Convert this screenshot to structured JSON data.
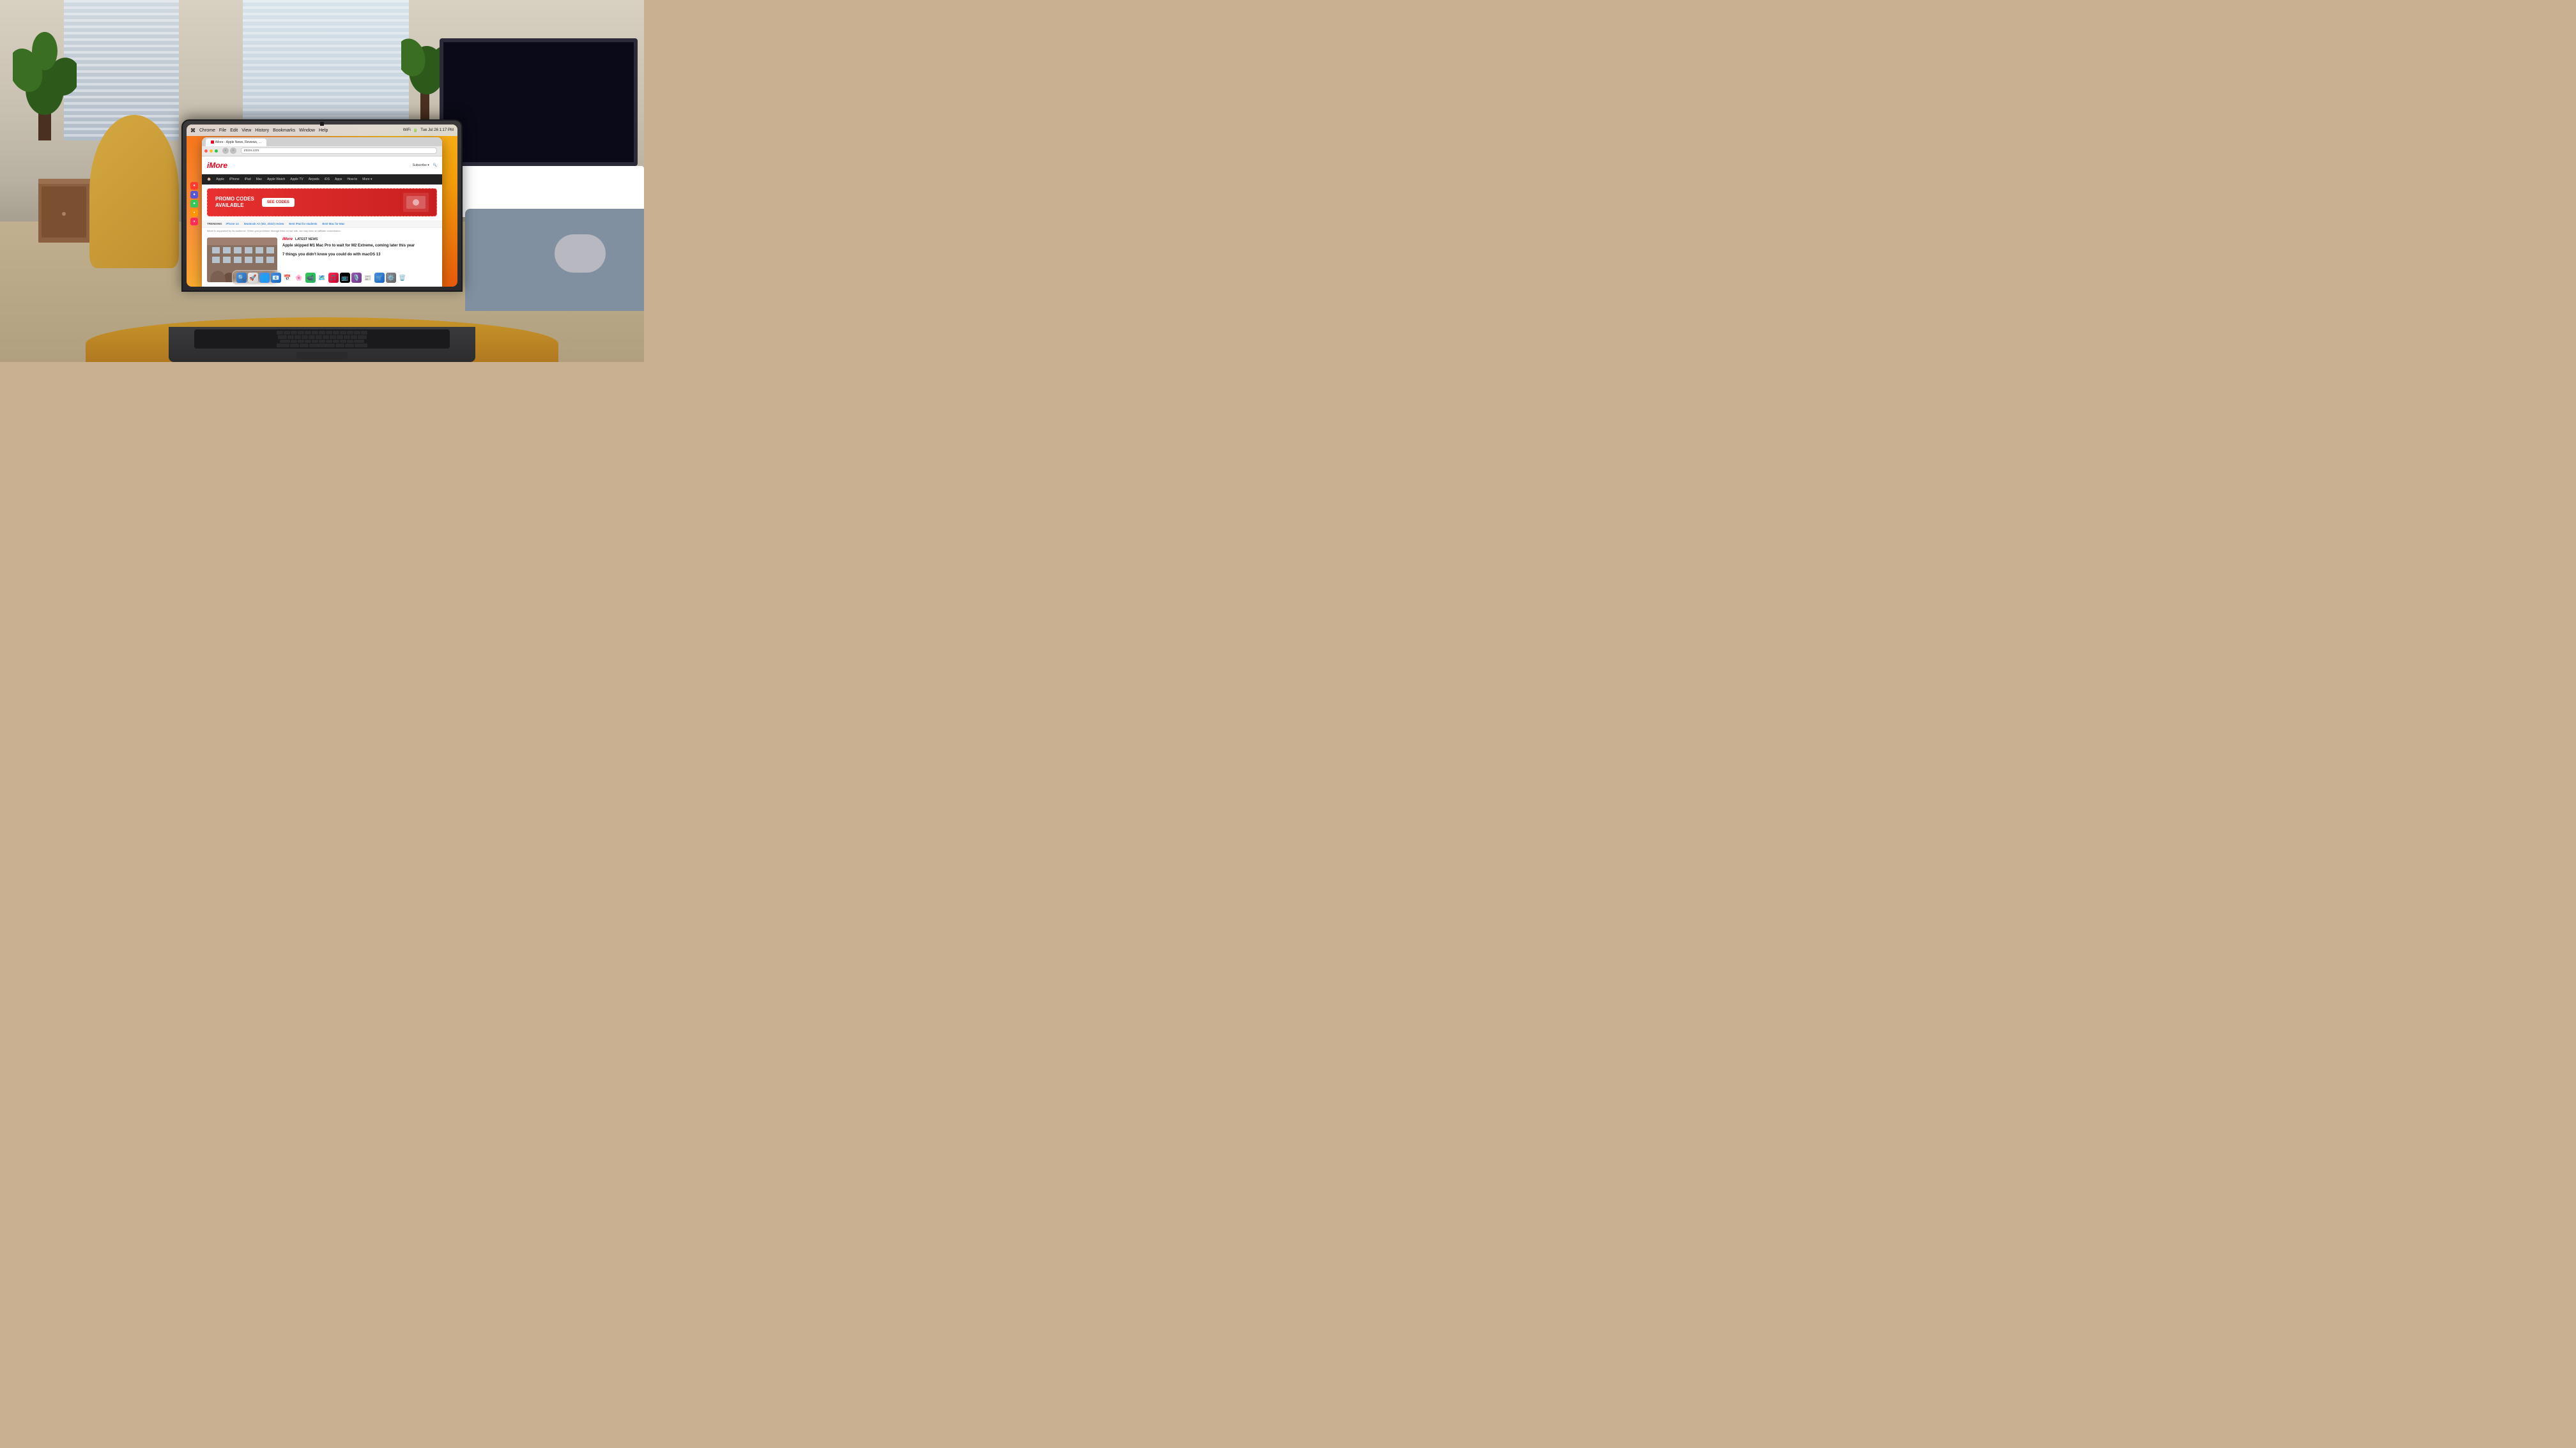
{
  "scene": {
    "description": "MacBook Pro on wooden table in living room"
  },
  "menubar": {
    "apple": "⌘",
    "app": "Chrome",
    "menus": [
      "File",
      "Edit",
      "View",
      "History",
      "Bookmarks",
      "Window",
      "Help"
    ],
    "time": "Tue Jul 26  1:17 PM",
    "battery": "🔋"
  },
  "browser": {
    "tab_label": "iMore - Apple News, Reviews, ...",
    "address": "imore.com",
    "nav_back": "‹",
    "nav_forward": "›"
  },
  "imore": {
    "logo": "iMore",
    "tagline": "Subscribe",
    "nav_items": [
      "Home",
      "Apple",
      "iPhone",
      "iPad",
      "Mac",
      "Apple Watch",
      "Apple TV",
      "Airpods",
      "iOS",
      "Apps",
      "How-to",
      "More"
    ],
    "promo": {
      "heading": "PROMO CODES",
      "subheading": "AVAILABLE",
      "button": "SEE CODES"
    },
    "trending_label": "TRENDING",
    "trending_items": [
      "iPhone 14",
      "MacBook Air (M2, 2022) review",
      "Best iPad for students",
      "Best Mac for Mac"
    ],
    "affiliate_text": "iMore is supported by its audience. When you purchase through links on our site, we may earn an affiliate commission.",
    "latest_news_label": "LATEST NEWS",
    "news_items": [
      {
        "title": "Apple skipped M1 Mac Pro to wait for M2 Extreme, coming later this year"
      },
      {
        "title": "7 things you didn't know you could do with macOS 13"
      }
    ]
  },
  "dock": {
    "icons": [
      "🔍",
      "📁",
      "🌐",
      "📧",
      "📅",
      "🎵",
      "🎬",
      "⚙️",
      "🗑️"
    ]
  }
}
